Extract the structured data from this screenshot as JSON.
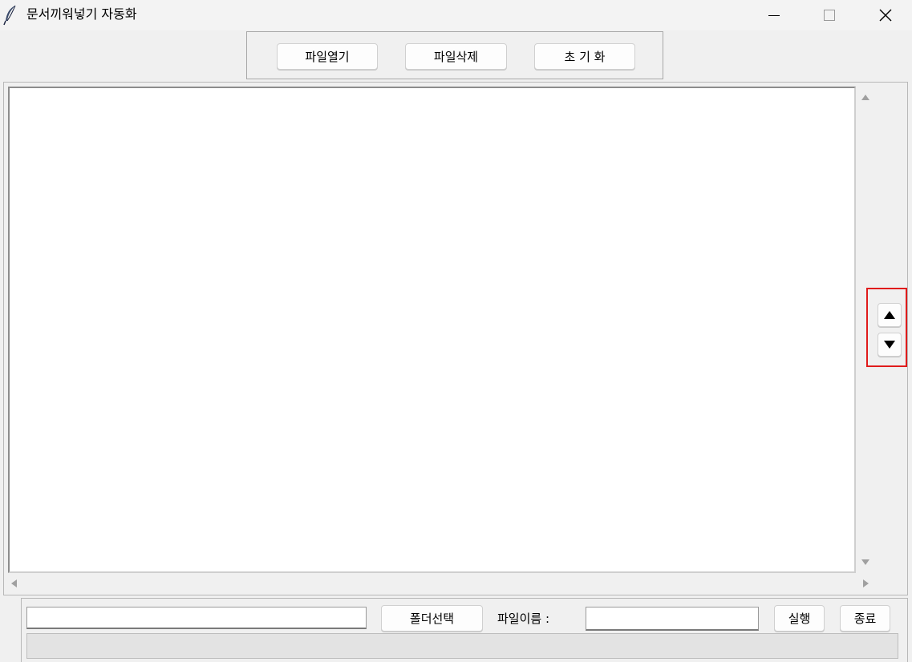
{
  "window": {
    "title": "문서끼워넣기 자동화",
    "icon": "feather-icon"
  },
  "toolbar": {
    "open_label": "파일열기",
    "delete_label": "파일삭제",
    "reset_label": "초 기 화"
  },
  "file_list": {
    "items": []
  },
  "move_buttons": {
    "up_icon": "triangle-up-icon",
    "down_icon": "triangle-down-icon",
    "highlight_color": "#e01b1b"
  },
  "bottom": {
    "folder_path_value": "",
    "folder_select_label": "폴더선택",
    "filename_label": "파일이름 :",
    "filename_value": "",
    "run_label": "실행",
    "exit_label": "종료",
    "status_text": ""
  }
}
